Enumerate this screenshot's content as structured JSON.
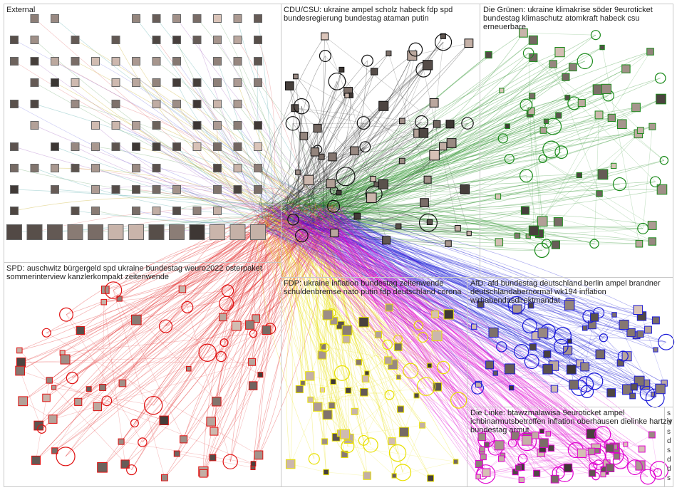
{
  "clusters": [
    {
      "id": "external",
      "label": "External",
      "color": "#888888"
    },
    {
      "id": "cdu",
      "label": "CDU/CSU: ukraine ampel scholz habeck fdp spd\nbundesregierung bundestag ataman putin",
      "color": "#111111"
    },
    {
      "id": "gruene",
      "label": "Die Grünen: ukraine klimakrise söder 9euroticket\nbundestag klimaschutz atomkraft habeck csu erneuerbare",
      "color": "#1a8a1a"
    },
    {
      "id": "spd",
      "label": "SPD: auschwitz bürgergeld spd ukraine bundestag weuro2022 osterpaket\nsommerinterview kanzlerkompakt zeitenwende",
      "color": "#e01010"
    },
    {
      "id": "fdp",
      "label": "FDP: ukraine inflation bundestag zeitenwende\nschuldenbremse nato putin fdp deutschland corona",
      "color": "#e8e000"
    },
    {
      "id": "afd",
      "label": "AfD: afd bundestag deutschland berlin ampel brandner\ndeutschlandabernormal wk194 inflation\nwirhabendasdirektmandat",
      "color": "#1a1ad8"
    },
    {
      "id": "linke",
      "label": "Die Linke: btawzmalawisa 9euroticket ampel\nichbinarmutsbetroffen inflation oberhausen dielinke hartziv\nbundestag armut",
      "color": "#e000d0"
    }
  ],
  "mini_cluster_labels": "s\nd\ns\nd\ns\nd\nd\ns"
}
